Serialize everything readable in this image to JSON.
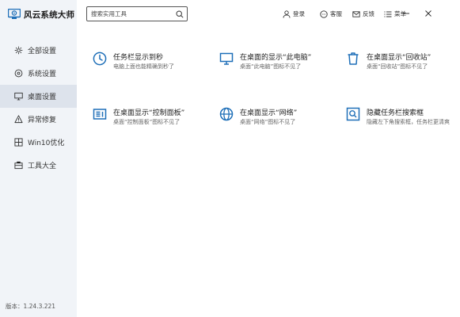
{
  "app": {
    "title": "风云系统大师",
    "version": "版本：1.24.3.221"
  },
  "search": {
    "placeholder": "搜索实用工具"
  },
  "topbar": {
    "login": "登录",
    "service": "客服",
    "feedback": "反馈",
    "menu": "菜单"
  },
  "sidebar": {
    "items": [
      {
        "label": "全部设置",
        "icon": "settings-icon"
      },
      {
        "label": "系统设置",
        "icon": "system-icon"
      },
      {
        "label": "桌面设置",
        "icon": "desktop-icon"
      },
      {
        "label": "异常修复",
        "icon": "warning-icon"
      },
      {
        "label": "Win10优化",
        "icon": "windows-icon"
      },
      {
        "label": "工具大全",
        "icon": "toolbox-icon"
      }
    ],
    "active": "桌面设置"
  },
  "cards": [
    {
      "title": "任务栏显示到秒",
      "desc": "电脑上面也能精确到秒了",
      "icon": "clock-icon"
    },
    {
      "title": "在桌面的显示“此电脑”",
      "desc": "桌面“此电脑”图标不见了",
      "icon": "monitor-icon"
    },
    {
      "title": "在桌面显示“回收站”",
      "desc": "桌面“回收站”图标不见了",
      "icon": "trash-icon"
    },
    {
      "title": "在桌面显示“控制面板”",
      "desc": "桌面“控制面板”图标不见了",
      "icon": "control-panel-icon"
    },
    {
      "title": "在桌面显示“网络”",
      "desc": "桌面“网络”图标不见了",
      "icon": "globe-icon"
    },
    {
      "title": "隐藏任务栏搜索框",
      "desc": "隐藏左下角搜索框，任务栏更清爽",
      "icon": "search-box-icon"
    }
  ],
  "colors": {
    "accent": "#1e6fb8",
    "sidebar_bg": "#f1f4f8",
    "sidebar_active": "#dde3ec"
  }
}
